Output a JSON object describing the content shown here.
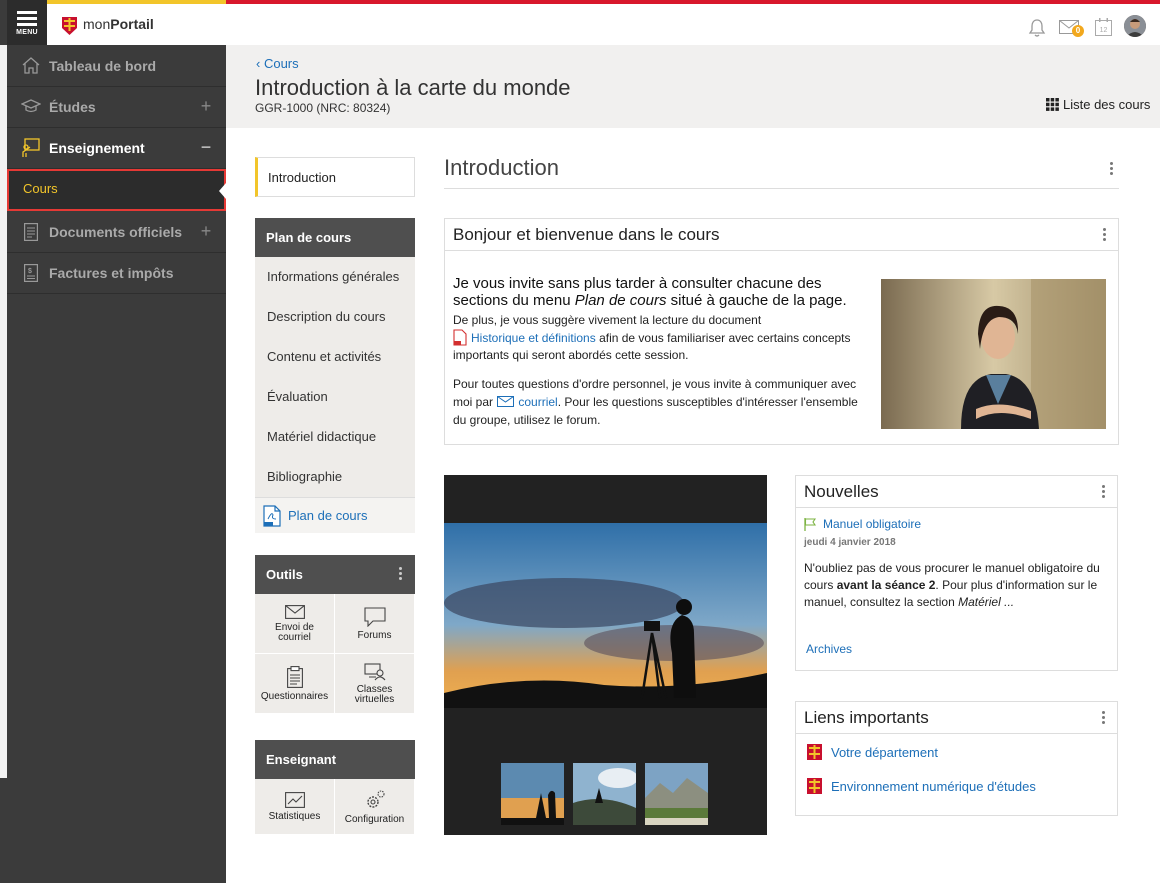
{
  "app": {
    "menu_label": "MENU",
    "logo_prefix": "mon",
    "logo_bold": "Portail"
  },
  "topbar": {
    "mail_badge": "0",
    "calendar_day": "12"
  },
  "sidebar": {
    "items": [
      {
        "label": "Tableau de bord",
        "icon": "home-icon"
      },
      {
        "label": "Études",
        "icon": "graduation-cap-icon",
        "toggle": "+"
      },
      {
        "label": "Enseignement",
        "icon": "teacher-icon",
        "toggle": "−"
      },
      {
        "label": "Cours"
      },
      {
        "label": "Documents officiels",
        "icon": "document-icon",
        "toggle": "+"
      },
      {
        "label": "Factures et impôts",
        "icon": "invoice-icon"
      }
    ]
  },
  "header": {
    "back": "Cours",
    "title": "Introduction à la carte du monde",
    "code": "GGR-1000 (NRC: 80324)",
    "course_list": "Liste des cours"
  },
  "leftnav": {
    "intro_tab": "Introduction",
    "plan_title": "Plan de cours",
    "plan_items": [
      "Informations générales",
      "Description du cours",
      "Contenu et activités",
      "Évaluation",
      "Matériel didactique",
      "Bibliographie"
    ],
    "plan_pdf": "Plan de cours",
    "tools_title": "Outils",
    "tools": [
      {
        "line1": "Envoi de",
        "line2": "courriel"
      },
      {
        "line1": "Forums",
        "line2": ""
      },
      {
        "line1": "Questionnaires",
        "line2": ""
      },
      {
        "line1": "Classes",
        "line2": "virtuelles"
      }
    ],
    "teacher_title": "Enseignant",
    "teacher_tools": [
      {
        "line1": "Statistiques"
      },
      {
        "line1": "Configuration"
      }
    ]
  },
  "main": {
    "section_title": "Introduction",
    "welcome": {
      "title": "Bonjour et bienvenue dans le cours",
      "big_1": "Je vous invite sans plus tarder à consulter chacune des sections du menu ",
      "big_em": "Plan de cours",
      "big_2": " situé à gauche de la page.",
      "p1_a": "De plus, je vous suggère vivement la lecture du document",
      "p1_link": "Historique et définitions",
      "p1_b": " afin de vous familiariser avec certains concepts importants qui seront abordés cette session.",
      "p2_a": "Pour toutes questions d'ordre personnel, je vous invite à communiquer avec moi par ",
      "p2_link": "courriel",
      "p2_b": ". Pour les questions susceptibles d'intéresser l'ensemble du groupe, utilisez le forum."
    },
    "news": {
      "title": "Nouvelles",
      "item_title": "Manuel obligatoire",
      "item_date": "jeudi 4 janvier 2018",
      "item_text_a": "N'oubliez pas de vous procurer le manuel obligatoire du cours ",
      "item_text_bold": "avant la séance 2",
      "item_text_b": ". Pour plus d'information sur le manuel, consultez la section ",
      "item_text_em": "Matériel ...",
      "archives": "Archives"
    },
    "links": {
      "title": "Liens importants",
      "items": [
        "Votre département",
        "Environnement numérique d'études"
      ]
    }
  },
  "colors": {
    "accent": "#f2c52a",
    "brand_red": "#d8182c",
    "link": "#1d6fb8",
    "sidebar": "#3b3b3b"
  }
}
